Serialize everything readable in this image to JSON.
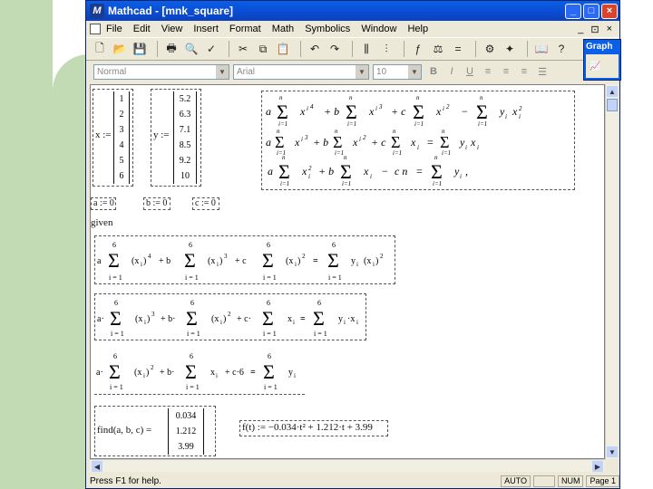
{
  "window": {
    "title": "Mathcad - [mnk_square]",
    "controls": [
      "_",
      "□",
      "×"
    ]
  },
  "menu": {
    "items": [
      "File",
      "Edit",
      "View",
      "Insert",
      "Format",
      "Math",
      "Symbolics",
      "Window",
      "Help"
    ],
    "mdi_controls": [
      "_",
      "⊡",
      "×"
    ]
  },
  "format_bar": {
    "style": "Normal",
    "font": "Arial",
    "size": "10",
    "bold": "B",
    "italic": "I",
    "underline": "U"
  },
  "graph_panel": {
    "title": "Graph"
  },
  "sheet": {
    "x_matrix": {
      "label": "x :=",
      "values": [
        "1",
        "2",
        "3",
        "4",
        "5",
        "6"
      ]
    },
    "y_matrix": {
      "label": "y :=",
      "values": [
        "5.2",
        "6.3",
        "7.1",
        "8.5",
        "9.2",
        "10"
      ]
    },
    "init": {
      "a": "a := 0",
      "b": "b := 0",
      "c": "c := 0"
    },
    "given": "given",
    "find_label": "find(a, b, c) =",
    "find_values": [
      "0.034",
      "1.212",
      "3.99"
    ],
    "fit_function": "f(t) := −0.034·t² + 1.212·t + 3.99"
  },
  "status": {
    "help": "Press F1 for help.",
    "auto": "AUTO",
    "num": "NUM",
    "page": "Page 1"
  }
}
